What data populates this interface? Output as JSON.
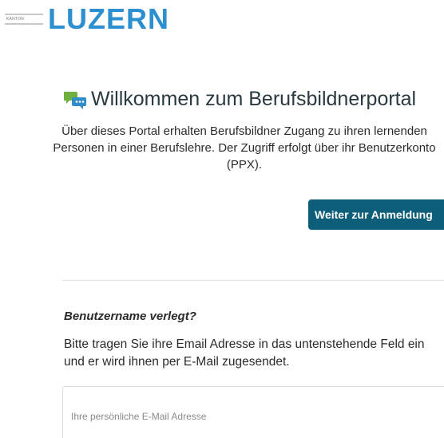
{
  "brand": {
    "name": "LUZERN",
    "small_label": "KANTON",
    "color": "#2c8fcf"
  },
  "welcome": {
    "icon": "chat-bubbles-icon",
    "title": "Willkommen zum Berufsbildnerportal",
    "description": "Über dieses Portal erhalten Berufsbildner Zugang zu ihren lernenden Personen in einer Berufslehre. Der Zugriff erfolgt über ihr Benutzerkonto (PPX).",
    "login_button": "Weiter zur Anmeldung",
    "button_color": "#0d5e78"
  },
  "forgot": {
    "title": "Benutzername verlegt?",
    "text": "Bitte tragen Sie ihre Email Adresse in das untenstehende Feld ein und er wird ihnen per E-Mail zugesendet.",
    "email_placeholder": "Ihre persönliche E-Mail Adresse",
    "email_value": ""
  }
}
